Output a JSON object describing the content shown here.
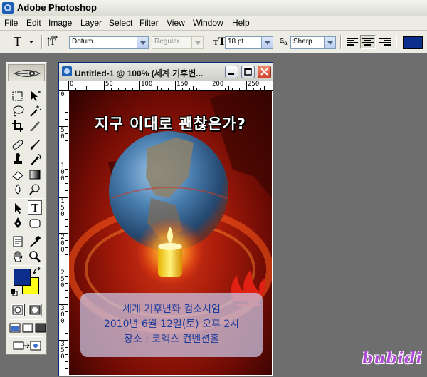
{
  "app": {
    "title": "Adobe Photoshop"
  },
  "menu": [
    "File",
    "Edit",
    "Image",
    "Layer",
    "Select",
    "Filter",
    "View",
    "Window",
    "Help"
  ],
  "options": {
    "font_family": "Dotum",
    "font_style": "Regular",
    "font_size": "18 pt",
    "antialias": "Sharp",
    "text_color": "#0b2e8c"
  },
  "toolbox": {
    "foreground_color": "#0b2e8c",
    "background_color": "#ffff1a",
    "active_tool": "type-tool"
  },
  "document": {
    "title": "Untitled-1 @ 100% (세계 기후변...",
    "ruler_top": [
      "0",
      "50",
      "100",
      "150",
      "200",
      "250"
    ],
    "ruler_left": [
      "0",
      "5",
      "0",
      "1",
      "0",
      "0",
      "1",
      "5",
      "0",
      "2",
      "0",
      "0",
      "2",
      "5",
      "0",
      "3",
      "0",
      "0",
      "3",
      "5",
      "0"
    ],
    "poster": {
      "headline": "지구 이대로 괜찮은가?",
      "line1": "세계 기후변화 컴소시엄",
      "line2": "2010년 6월 12일(토) 오후 2시",
      "line3": "장소 : 코엑스 컨벤션홀"
    }
  },
  "watermark": "bubidi"
}
